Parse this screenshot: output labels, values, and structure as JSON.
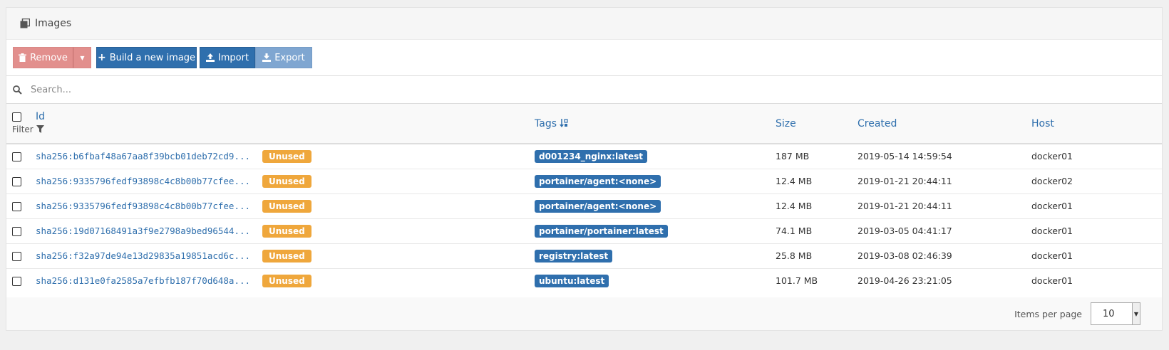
{
  "panel": {
    "title": "Images",
    "icon": "clone-icon"
  },
  "toolbar": {
    "remove_label": "Remove",
    "build_label": "Build a new image",
    "import_label": "Import",
    "export_label": "Export"
  },
  "search": {
    "placeholder": "Search..."
  },
  "table": {
    "headers": {
      "id": "Id",
      "filter": "Filter",
      "tags": "Tags",
      "size": "Size",
      "created": "Created",
      "host": "Host"
    },
    "rows": [
      {
        "id": "sha256:b6fbaf48a67aa8f39bcb01deb72cd9...",
        "badge": "Unused",
        "tag": "d001234_nginx:latest",
        "size": "187 MB",
        "created": "2019-05-14 14:59:54",
        "host": "docker01"
      },
      {
        "id": "sha256:9335796fedf93898c4c8b00b77cfee...",
        "badge": "Unused",
        "tag": "portainer/agent:<none>",
        "size": "12.4 MB",
        "created": "2019-01-21 20:44:11",
        "host": "docker02"
      },
      {
        "id": "sha256:9335796fedf93898c4c8b00b77cfee...",
        "badge": "Unused",
        "tag": "portainer/agent:<none>",
        "size": "12.4 MB",
        "created": "2019-01-21 20:44:11",
        "host": "docker01"
      },
      {
        "id": "sha256:19d07168491a3f9e2798a9bed96544...",
        "badge": "Unused",
        "tag": "portainer/portainer:latest",
        "size": "74.1 MB",
        "created": "2019-03-05 04:41:17",
        "host": "docker01"
      },
      {
        "id": "sha256:f32a97de94e13d29835a19851acd6c...",
        "badge": "Unused",
        "tag": "registry:latest",
        "size": "25.8 MB",
        "created": "2019-03-08 02:46:39",
        "host": "docker01"
      },
      {
        "id": "sha256:d131e0fa2585a7efbfb187f70d648a...",
        "badge": "Unused",
        "tag": "ubuntu:latest",
        "size": "101.7 MB",
        "created": "2019-04-26 23:21:05",
        "host": "docker01"
      }
    ]
  },
  "pagination": {
    "label": "Items per page",
    "value": "10"
  },
  "colors": {
    "primary": "#2f6fad",
    "danger_disabled": "#e28f8d",
    "warning": "#efa73c"
  }
}
